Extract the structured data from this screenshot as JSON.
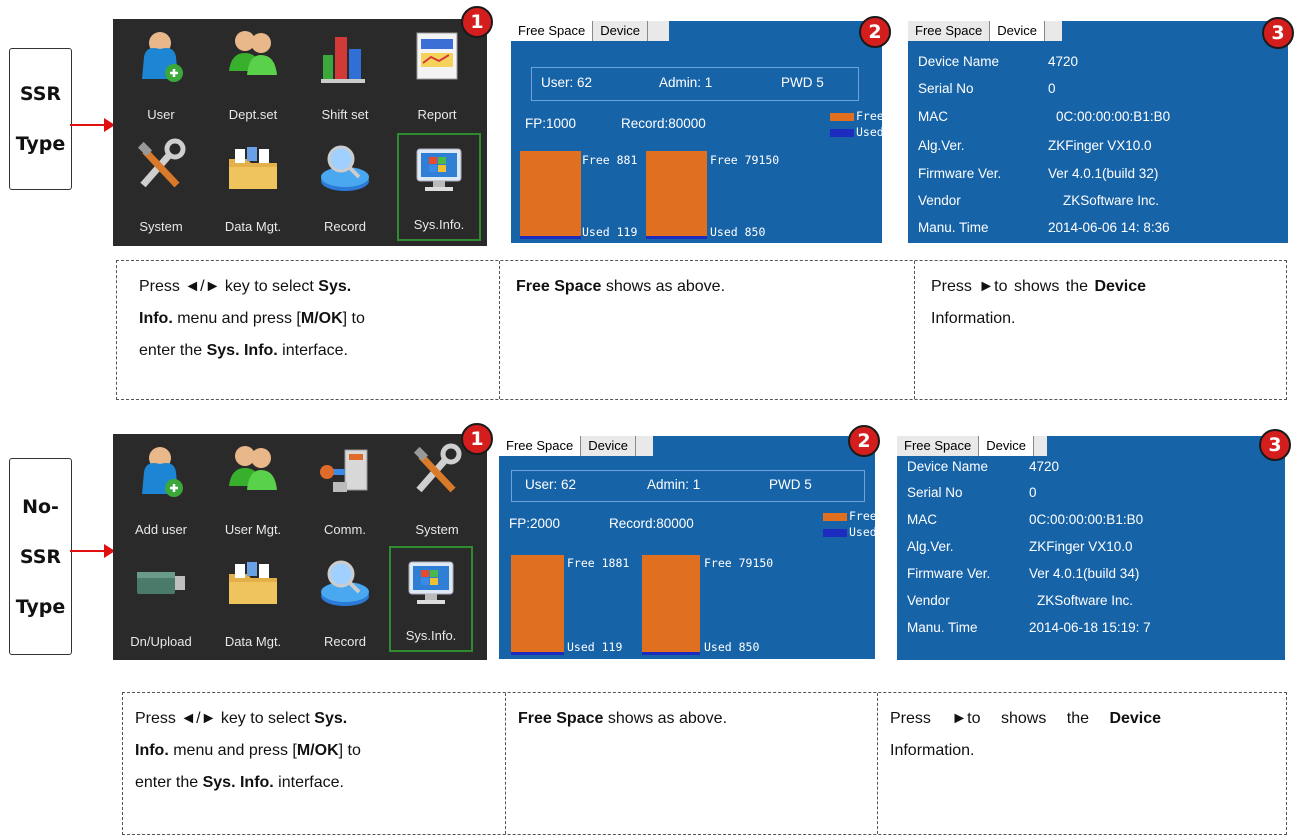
{
  "type_labels": {
    "ssr": [
      "SSR",
      "Type"
    ],
    "nossr": [
      "No-",
      "SSR",
      "Type"
    ]
  },
  "badges": [
    "1",
    "2",
    "3"
  ],
  "sections": [
    {
      "menu": [
        "User",
        "Dept.set",
        "Shift set",
        "Report",
        "System",
        "Data Mgt.",
        "Record",
        "Sys.Info."
      ],
      "menu_icons": [
        "user-add-icon",
        "users-group-icon",
        "bar-chart-icon",
        "report-icon",
        "tools-icon",
        "folder-icon",
        "record-search-icon",
        "monitor-icon"
      ],
      "free_space": {
        "tabs": [
          "Free Space",
          "Device"
        ],
        "user": "User: 62",
        "admin": "Admin: 1",
        "pwd": "PWD 5",
        "fp": "FP:1000",
        "record": "Record:80000",
        "legend_free": "Free",
        "legend_used": "Used",
        "fp_free_label": "Free 881",
        "fp_used_label": "Used 119",
        "rec_free_label": "Free 79150",
        "rec_used_label": "Used 850",
        "fp_free": 881,
        "fp_used": 119,
        "rec_free": 79150,
        "rec_used": 850
      },
      "device": {
        "tabs": [
          "Free Space",
          "Device"
        ],
        "rows": [
          [
            "Device Name",
            "4720"
          ],
          [
            "Serial No",
            "0"
          ],
          [
            "MAC",
            "0C:00:00:00:B1:B0"
          ],
          [
            "Alg.Ver.",
            "ZKFinger VX10.0"
          ],
          [
            "Firmware Ver.",
            "Ver 4.0.1(build 32)"
          ],
          [
            "Vendor",
            "ZKSoftware Inc."
          ],
          [
            "Manu. Time",
            "2014-06-06 14: 8:36"
          ]
        ]
      }
    },
    {
      "menu": [
        "Add user",
        "User Mgt.",
        "Comm.",
        "System",
        "Dn/Upload",
        "Data Mgt.",
        "Record",
        "Sys.Info."
      ],
      "menu_icons": [
        "user-add-icon",
        "users-group-icon",
        "comm-icon",
        "tools-icon",
        "usb-drive-icon",
        "folder-icon",
        "record-search-icon",
        "monitor-icon"
      ],
      "free_space": {
        "tabs": [
          "Free Space",
          "Device"
        ],
        "user": "User: 62",
        "admin": "Admin: 1",
        "pwd": "PWD 5",
        "fp": "FP:2000",
        "record": "Record:80000",
        "legend_free": "Free",
        "legend_used": "Used",
        "fp_free_label": "Free 1881",
        "fp_used_label": "Used 119",
        "rec_free_label": "Free 79150",
        "rec_used_label": "Used 850",
        "fp_free": 1881,
        "fp_used": 119,
        "rec_free": 79150,
        "rec_used": 850
      },
      "device": {
        "tabs": [
          "Free Space",
          "Device"
        ],
        "rows": [
          [
            "Device Name",
            "4720"
          ],
          [
            "Serial No",
            "0"
          ],
          [
            "MAC",
            "0C:00:00:00:B1:B0"
          ],
          [
            "Alg.Ver.",
            "ZKFinger VX10.0"
          ],
          [
            "Firmware Ver.",
            "Ver 4.0.1(build 34)"
          ],
          [
            "Vendor",
            "ZKSoftware Inc."
          ],
          [
            "Manu. Time",
            "2014-06-18 15:19: 7"
          ]
        ]
      }
    }
  ],
  "descriptions": {
    "col1": {
      "t1": "Press ◄/► key to select ",
      "b1": "Sys.",
      "b1b": "Info.",
      "t2": " menu and press [",
      "b2": "M/OK",
      "t3": "] to",
      "t4": "enter the ",
      "b3": "Sys. Info.",
      "t5": " interface."
    },
    "col2": {
      "b1": "Free Space",
      "t1": " shows as above."
    },
    "col3": {
      "t1": "Press ►to shows the ",
      "b1": "Device",
      "t2": "Information."
    }
  }
}
